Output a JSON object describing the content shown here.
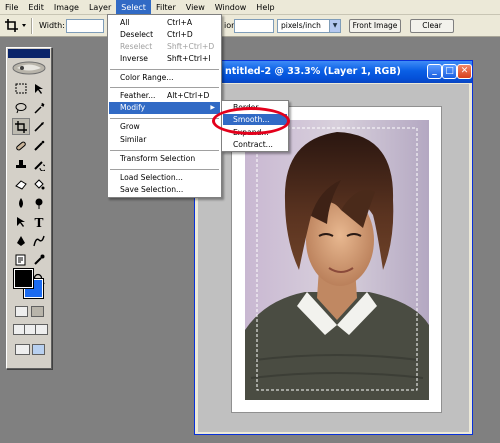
{
  "menubar": {
    "items": [
      "File",
      "Edit",
      "Image",
      "Layer",
      "Select",
      "Filter",
      "View",
      "Window",
      "Help"
    ],
    "active_index": 4
  },
  "options_bar": {
    "width_label": "Width:",
    "resolution_label": "ion:",
    "units_value": "pixels/inch",
    "front_image_button": "Front Image",
    "clear_button": "Clear"
  },
  "select_menu": {
    "items": [
      {
        "label": "All",
        "shortcut": "Ctrl+A",
        "disabled": false
      },
      {
        "label": "Deselect",
        "shortcut": "Ctrl+D",
        "disabled": false
      },
      {
        "label": "Reselect",
        "shortcut": "Shft+Ctrl+D",
        "disabled": true
      },
      {
        "label": "Inverse",
        "shortcut": "Shft+Ctrl+I",
        "disabled": false
      },
      {
        "label": "Color Range...",
        "shortcut": "",
        "disabled": false
      },
      {
        "label": "Feather...",
        "shortcut": "Alt+Ctrl+D",
        "disabled": false
      },
      {
        "label": "Modify",
        "shortcut": "",
        "disabled": false,
        "submenu": true
      },
      {
        "label": "Grow",
        "shortcut": "",
        "disabled": false
      },
      {
        "label": "Similar",
        "shortcut": "",
        "disabled": false
      },
      {
        "label": "Transform Selection",
        "shortcut": "",
        "disabled": false
      },
      {
        "label": "Load Selection...",
        "shortcut": "",
        "disabled": false
      },
      {
        "label": "Save Selection...",
        "shortcut": "",
        "disabled": false
      }
    ]
  },
  "modify_submenu": {
    "items": [
      "Border...",
      "Smooth...",
      "Expand...",
      "Contract..."
    ],
    "highlighted_index": 1
  },
  "document": {
    "title": "ntitled-2 @ 33.3% (Layer 1, RGB)",
    "minimize_glyph": "_",
    "maximize_glyph": "□",
    "close_glyph": "✕"
  },
  "colors": {
    "menu_highlight": "#316ac5",
    "foreground_swatch": "#000000",
    "background_swatch": "#1a6af0",
    "annotation_ring": "#e3001b"
  }
}
